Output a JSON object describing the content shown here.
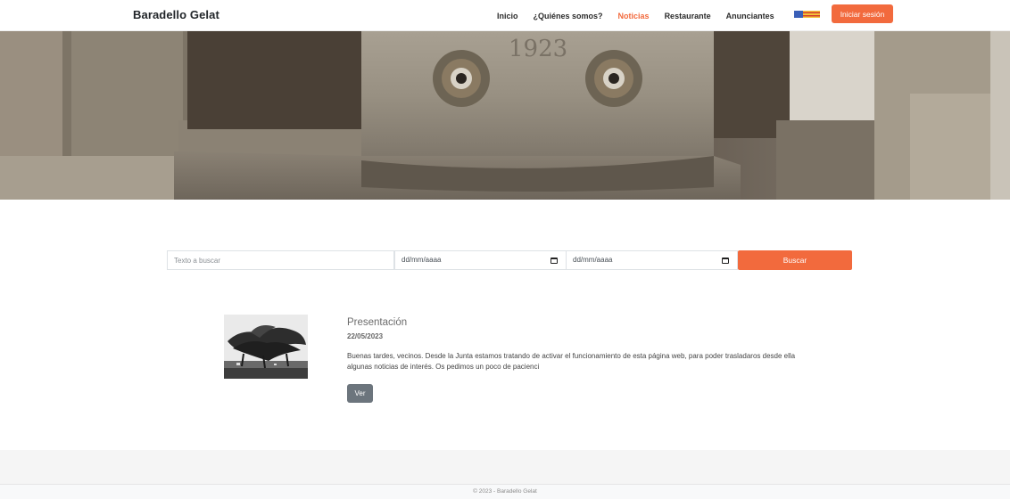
{
  "header": {
    "brand": "Baradello Gelat",
    "nav": [
      {
        "label": "Inicio",
        "active": false
      },
      {
        "label": "¿Quiénes somos?",
        "active": false
      },
      {
        "label": "Noticias",
        "active": true
      },
      {
        "label": "Restaurante",
        "active": false
      },
      {
        "label": "Anunciantes",
        "active": false
      }
    ],
    "language_flag_icon": "valencian-flag-icon",
    "login_label": "Iniciar sesión"
  },
  "hero": {
    "engraved_year": "1923"
  },
  "search": {
    "text_placeholder": "Texto a buscar",
    "date_from_value": "dd/mm/aaaa",
    "date_to_value": "dd/mm/aaaa",
    "calendar_icon": "calendar-icon",
    "button_label": "Buscar"
  },
  "news": [
    {
      "title": "Presentación",
      "date": "22/05/2023",
      "body": "Buenas tardes, vecinos. Desde la Junta estamos tratando de activar el funcionamiento de esta página web, para poder trasladaros desde ella algunas noticias de interés. Os pedimos un poco de pacienci",
      "button_label": "Ver"
    }
  ],
  "footer": {
    "text": "© 2023 - Baradello Gelat"
  },
  "colors": {
    "accent": "#f26a3d",
    "secondary_button": "#6c757d",
    "footer_bg": "#f5f5f5"
  }
}
